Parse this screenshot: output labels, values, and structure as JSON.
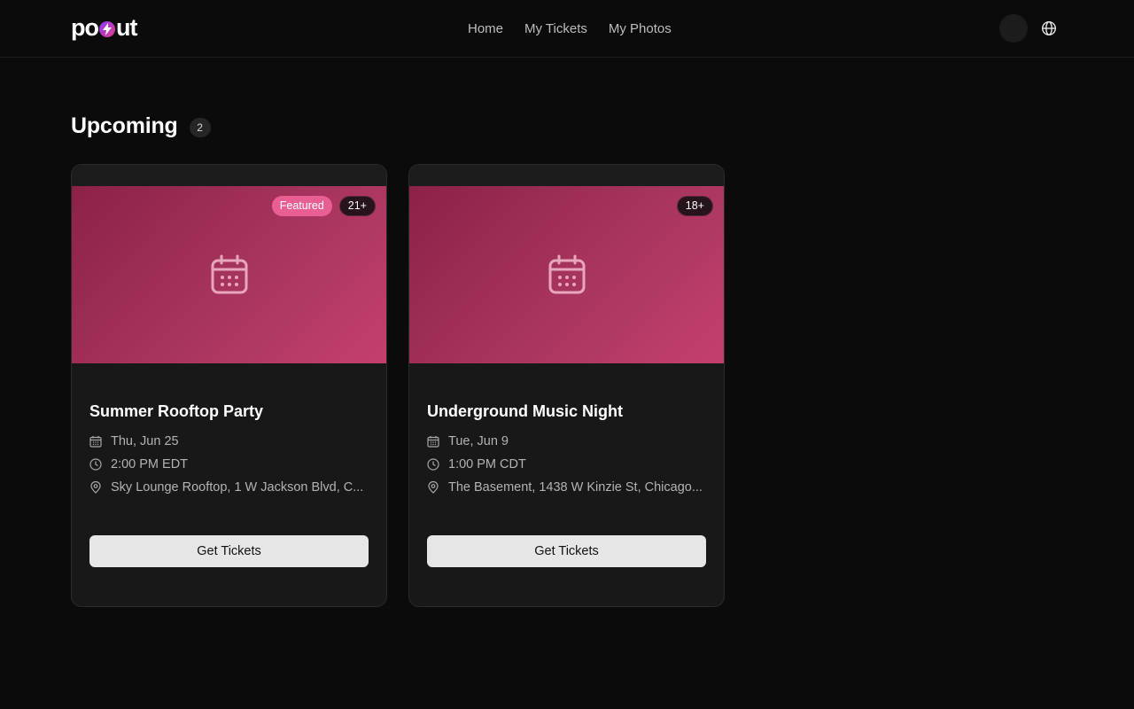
{
  "brand": {
    "logo_text_left": "po",
    "logo_text_right": "ut"
  },
  "nav": [
    {
      "label": "Home"
    },
    {
      "label": "My Tickets"
    },
    {
      "label": "My Photos"
    }
  ],
  "section": {
    "title": "Upcoming",
    "count": "2"
  },
  "events": [
    {
      "badge_featured": "Featured",
      "badge_age": "21+",
      "title": "Summer Rooftop Party",
      "date": "Thu, Jun 25",
      "time": "2:00 PM EDT",
      "location": "Sky Lounge Rooftop, 1 W Jackson Blvd, C...",
      "cta": "Get Tickets"
    },
    {
      "badge_age": "18+",
      "title": "Underground Music Night",
      "date": "Tue, Jun 9",
      "time": "1:00 PM CDT",
      "location": "The Basement, 1438 W Kinzie St, Chicago...",
      "cta": "Get Tickets"
    }
  ],
  "colors": {
    "background": "#0b0b0b",
    "card": "#181818",
    "banner_start": "#8c2148",
    "banner_end": "#c43f6e",
    "featured": "#ea5f93",
    "button": "#e6e6e6"
  }
}
